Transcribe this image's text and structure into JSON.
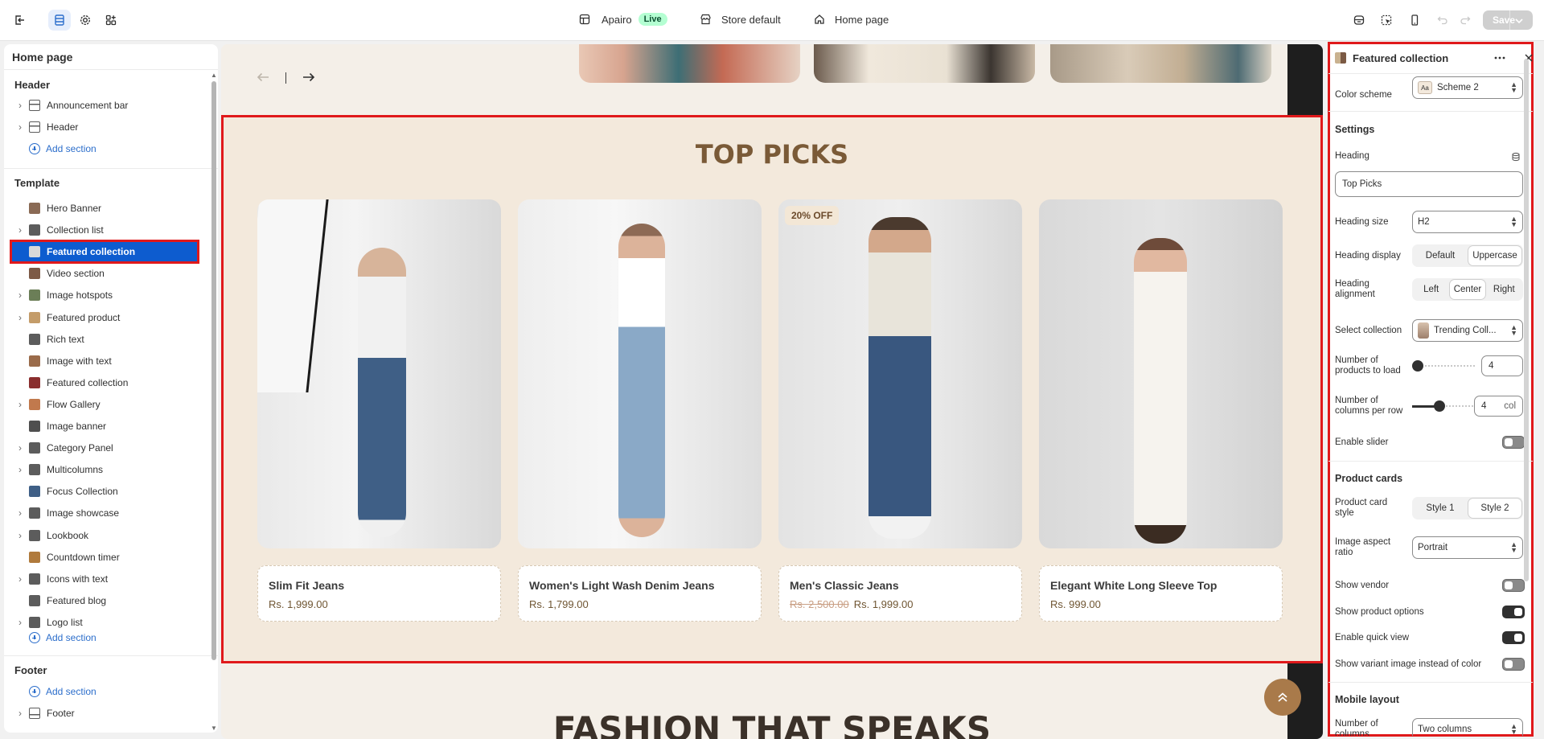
{
  "topbar": {
    "store_name": "Apairo",
    "live_badge": "Live",
    "theme_label": "Store default",
    "page_label": "Home page",
    "save_label": "Save"
  },
  "left_panel": {
    "title": "Home page",
    "header_group": "Header",
    "header_items": [
      "Announcement bar",
      "Header"
    ],
    "add_section": "Add section",
    "template_group": "Template",
    "template_items": [
      "Hero Banner",
      "Collection list",
      "Featured collection",
      "Video section",
      "Image hotspots",
      "Featured product",
      "Rich text",
      "Image with text",
      "Featured collection",
      "Flow Gallery",
      "Image banner",
      "Category Panel",
      "Multicolumns",
      "Focus Collection",
      "Image showcase",
      "Lookbook",
      "Countdown timer",
      "Icons with text",
      "Featured blog",
      "Logo list"
    ],
    "footer_group": "Footer",
    "footer_items": [
      "Footer"
    ]
  },
  "canvas": {
    "section_heading": "TOP PICKS",
    "discount_badge": "20% OFF",
    "next_heading": "FASHION THAT SPEAKS",
    "products": [
      {
        "title": "Slim Fit Jeans",
        "price": "Rs. 1,999.00",
        "compare_price": ""
      },
      {
        "title": "Women's Light Wash Denim Jeans",
        "price": "Rs. 1,799.00",
        "compare_price": ""
      },
      {
        "title": "Men's Classic Jeans",
        "price": "Rs. 1,999.00",
        "compare_price": "Rs. 2,500.00"
      },
      {
        "title": "Elegant White Long Sleeve Top",
        "price": "Rs. 999.00",
        "compare_price": ""
      }
    ]
  },
  "right_panel": {
    "title": "Featured collection",
    "color_scheme_label": "Color scheme",
    "color_scheme_value": "Scheme 2",
    "color_scheme_swatch": "Aa",
    "settings_heading": "Settings",
    "heading_label": "Heading",
    "heading_value": "Top Picks",
    "heading_size_label": "Heading size",
    "heading_size_value": "H2",
    "heading_display_label": "Heading display",
    "heading_display_options": [
      "Default",
      "Uppercase"
    ],
    "heading_display_selected": "Uppercase",
    "heading_alignment_label": "Heading alignment",
    "heading_alignment_options": [
      "Left",
      "Center",
      "Right"
    ],
    "heading_alignment_selected": "Center",
    "select_collection_label": "Select collection",
    "select_collection_value": "Trending Coll...",
    "products_to_load_label": "Number of products to load",
    "products_to_load_value": "4",
    "columns_per_row_label": "Number of columns per row",
    "columns_per_row_value": "4",
    "columns_unit": "col",
    "enable_slider_label": "Enable slider",
    "enable_slider": false,
    "product_cards_heading": "Product cards",
    "product_card_style_label": "Product card style",
    "product_card_style_options": [
      "Style 1",
      "Style 2"
    ],
    "product_card_style_selected": "Style 2",
    "image_aspect_ratio_label": "Image aspect ratio",
    "image_aspect_ratio_value": "Portrait",
    "show_vendor_label": "Show vendor",
    "show_vendor": false,
    "show_product_options_label": "Show product options",
    "show_product_options": true,
    "enable_quick_view_label": "Enable quick view",
    "enable_quick_view": true,
    "show_variant_image_label": "Show variant image instead of color",
    "show_variant_image": false,
    "mobile_layout_heading": "Mobile layout",
    "mobile_columns_label": "Number of columns",
    "mobile_columns_value": "Two columns"
  }
}
